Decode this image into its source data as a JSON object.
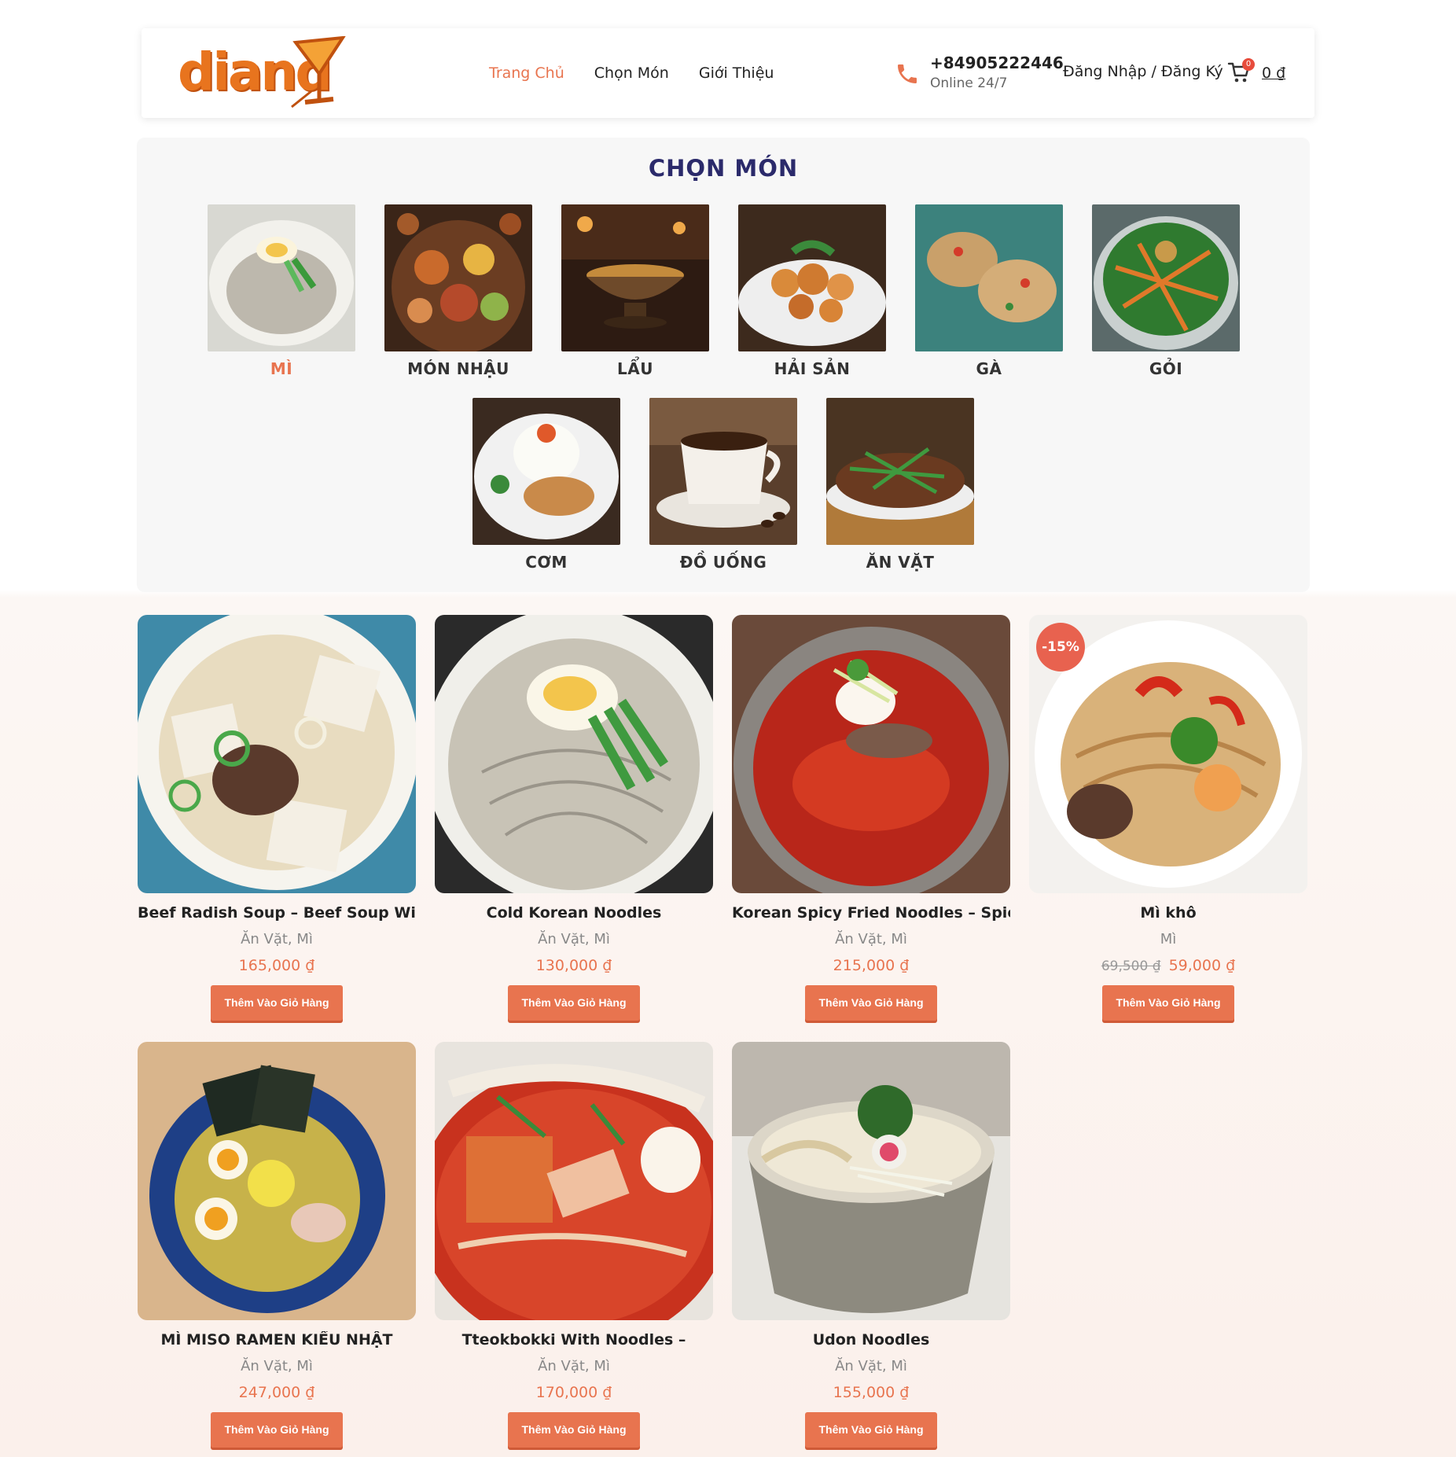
{
  "brand": {
    "logo_text": "diand"
  },
  "nav": {
    "items": [
      "Trang Chủ",
      "Chọn Món",
      "Giới Thiệu"
    ]
  },
  "contact": {
    "phone": "+84905222446",
    "sub": "Online 24/7"
  },
  "account": {
    "login_label": "Đăng Nhập / Đăng Ký"
  },
  "cart": {
    "count": "0",
    "total": "0 ₫"
  },
  "categories": {
    "title": "CHỌN MÓN",
    "items": [
      "MÌ",
      "MÓN NHẬU",
      "LẨU",
      "HẢI SẢN",
      "GÀ",
      "GỎI",
      "CƠM",
      "ĐỒ UỐNG",
      "ĂN VẶT"
    ]
  },
  "products": [
    {
      "name": "Beef Radish Soup – Beef Soup With",
      "category": "Ăn Vặt, Mì",
      "price": "165,000 ₫",
      "button": "Thêm Vào Giỏ Hàng"
    },
    {
      "name": "Cold Korean Noodles",
      "category": "Ăn Vặt, Mì",
      "price": "130,000 ₫",
      "button": "Thêm Vào Giỏ Hàng"
    },
    {
      "name": "Korean Spicy Fried Noodles – Spicy",
      "category": "Ăn Vặt, Mì",
      "price": "215,000 ₫",
      "button": "Thêm Vào Giỏ Hàng"
    },
    {
      "name": "Mì khô",
      "category": "Mì",
      "old_price": "69,500 ₫",
      "price": "59,000 ₫",
      "badge": "-15%",
      "button": "Thêm Vào Giỏ Hàng"
    },
    {
      "name": "MÌ MISO RAMEN KIỂU NHẬT",
      "category": "Ăn Vặt, Mì",
      "price": "247,000 ₫",
      "button": "Thêm Vào Giỏ Hàng"
    },
    {
      "name": "Tteokbokki With Noodles –",
      "category": "Ăn Vặt, Mì",
      "price": "170,000 ₫",
      "button": "Thêm Vào Giỏ Hàng"
    },
    {
      "name": "Udon Noodles",
      "category": "Ăn Vặt, Mì",
      "price": "155,000 ₫",
      "button": "Thêm Vào Giỏ Hàng"
    }
  ],
  "colors": {
    "accent": "#e8744f",
    "title": "#2b2a6b",
    "logo": "#e8741e"
  }
}
